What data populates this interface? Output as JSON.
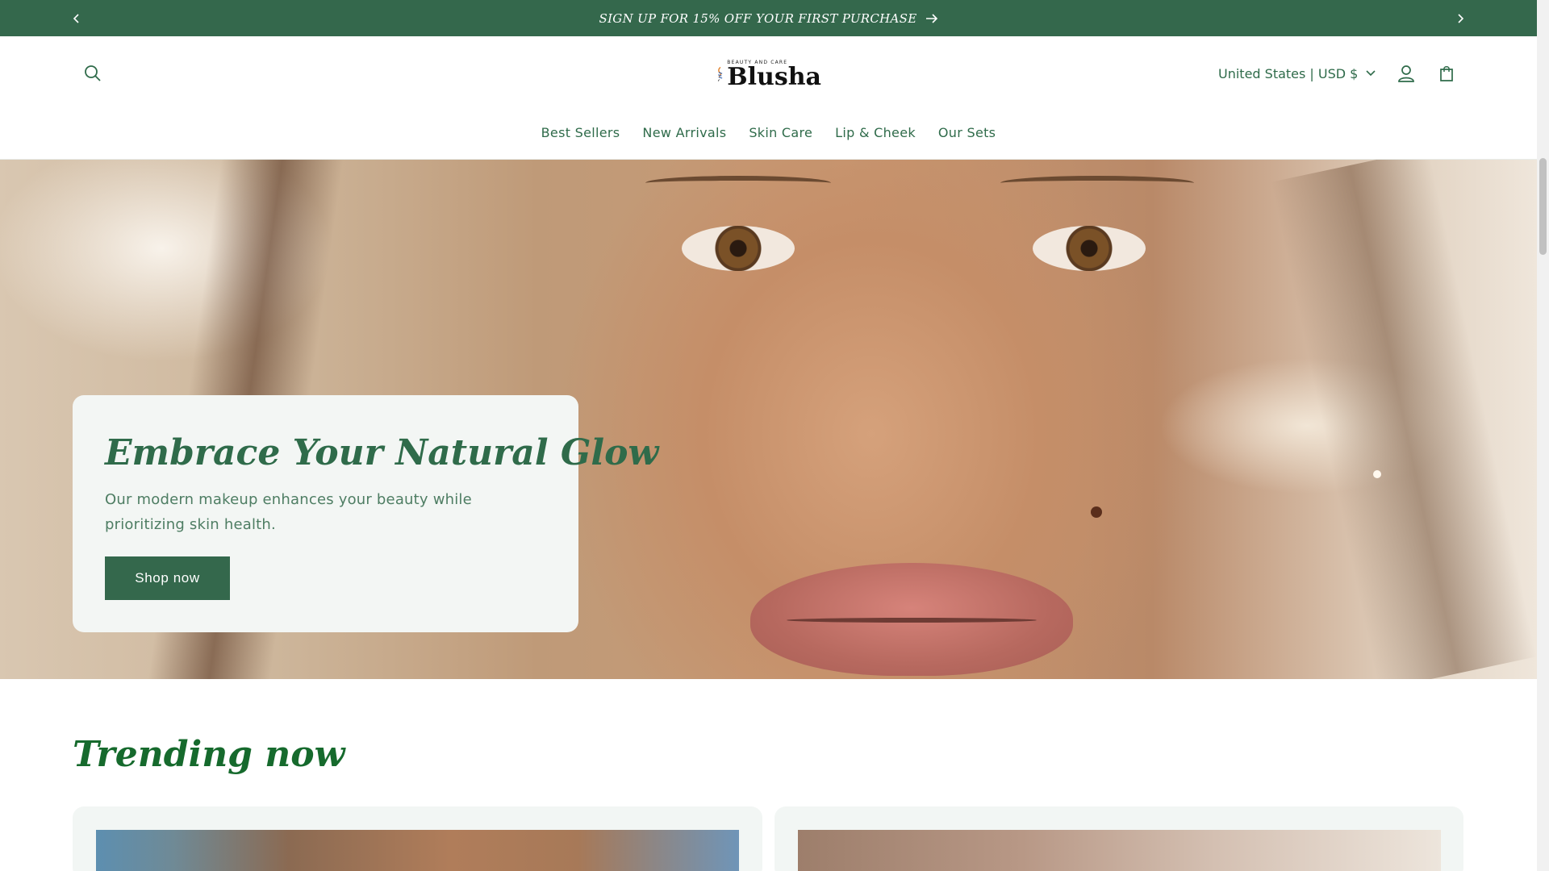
{
  "announcement": {
    "text": "SIGN UP FOR 15% OFF YOUR FIRST PURCHASE"
  },
  "header": {
    "logo_name": "Blusha",
    "logo_tagline": "BEAUTY AND CARE",
    "currency": "United States | USD $"
  },
  "nav": {
    "items": [
      {
        "label": "Best Sellers"
      },
      {
        "label": "New Arrivals"
      },
      {
        "label": "Skin Care"
      },
      {
        "label": "Lip & Cheek"
      },
      {
        "label": "Our Sets"
      }
    ]
  },
  "hero": {
    "title": "Embrace Your Natural Glow",
    "subtitle": "Our modern makeup enhances your beauty while prioritizing skin health.",
    "button": "Shop now"
  },
  "trending": {
    "title": "Trending now"
  },
  "colors": {
    "brand_green": "#34684c",
    "text_green": "#2f6b4a",
    "heading_green": "#166a2d",
    "card_bg": "#f3f6f4"
  }
}
